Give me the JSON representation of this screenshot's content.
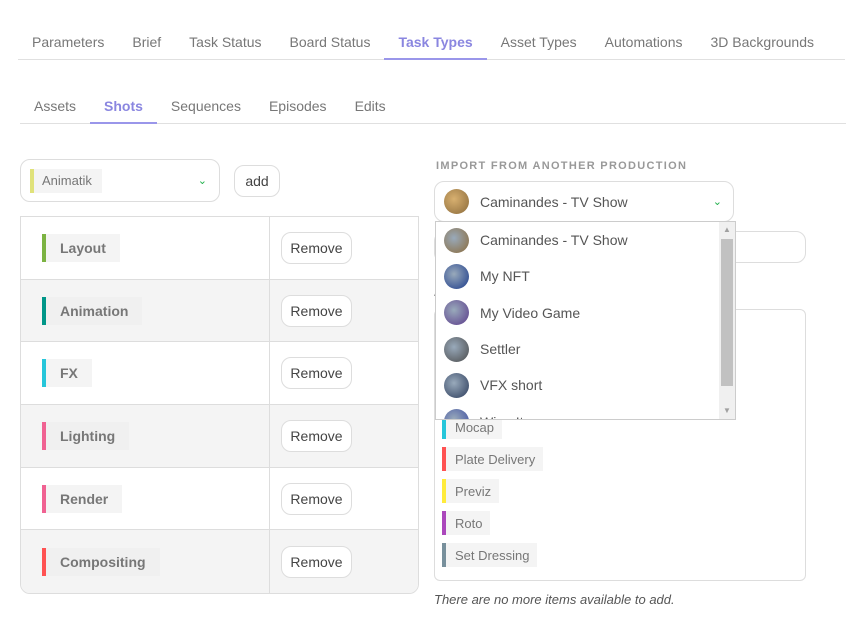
{
  "main_tabs": [
    {
      "label": "Parameters",
      "active": false
    },
    {
      "label": "Brief",
      "active": false
    },
    {
      "label": "Task Status",
      "active": false
    },
    {
      "label": "Board Status",
      "active": false
    },
    {
      "label": "Task Types",
      "active": true
    },
    {
      "label": "Asset Types",
      "active": false
    },
    {
      "label": "Automations",
      "active": false
    },
    {
      "label": "3D Backgrounds",
      "active": false
    }
  ],
  "sub_tabs": [
    {
      "label": "Assets",
      "active": false
    },
    {
      "label": "Shots",
      "active": true
    },
    {
      "label": "Sequences",
      "active": false
    },
    {
      "label": "Episodes",
      "active": false
    },
    {
      "label": "Edits",
      "active": false
    }
  ],
  "task_type_select": {
    "value": "Animatik",
    "color": "#e0e27a"
  },
  "add_label": "add",
  "remove_label": "Remove",
  "task_types": [
    {
      "name": "Layout",
      "color": "#7cb342"
    },
    {
      "name": "Animation",
      "color": "#009688"
    },
    {
      "name": "FX",
      "color": "#26c6da"
    },
    {
      "name": "Lighting",
      "color": "#f06292"
    },
    {
      "name": "Render",
      "color": "#f06292"
    },
    {
      "name": "Compositing",
      "color": "#ff5252"
    }
  ],
  "import": {
    "label": "IMPORT FROM ANOTHER PRODUCTION",
    "selected": "Caminandes - TV Show",
    "options": [
      {
        "name": "Caminandes - TV Show",
        "avatar": "#8a6a3a"
      },
      {
        "name": "My NFT",
        "avatar": "#1a3a8a"
      },
      {
        "name": "My Video Game",
        "avatar": "#5a3a8a"
      },
      {
        "name": "Settler",
        "avatar": "#4a4a4a"
      },
      {
        "name": "VFX short",
        "avatar": "#2a3a5a"
      },
      {
        "name": "Wing It",
        "avatar": "#3a4aa0"
      }
    ]
  },
  "available_types": [
    {
      "name": "Mocap",
      "color": "#26c6da"
    },
    {
      "name": "Plate Delivery",
      "color": "#ff5252"
    },
    {
      "name": "Previz",
      "color": "#ffeb3b"
    },
    {
      "name": "Roto",
      "color": "#ab47bc"
    },
    {
      "name": "Set Dressing",
      "color": "#78909c"
    }
  ],
  "no_more_text": "There are no more items available to add."
}
